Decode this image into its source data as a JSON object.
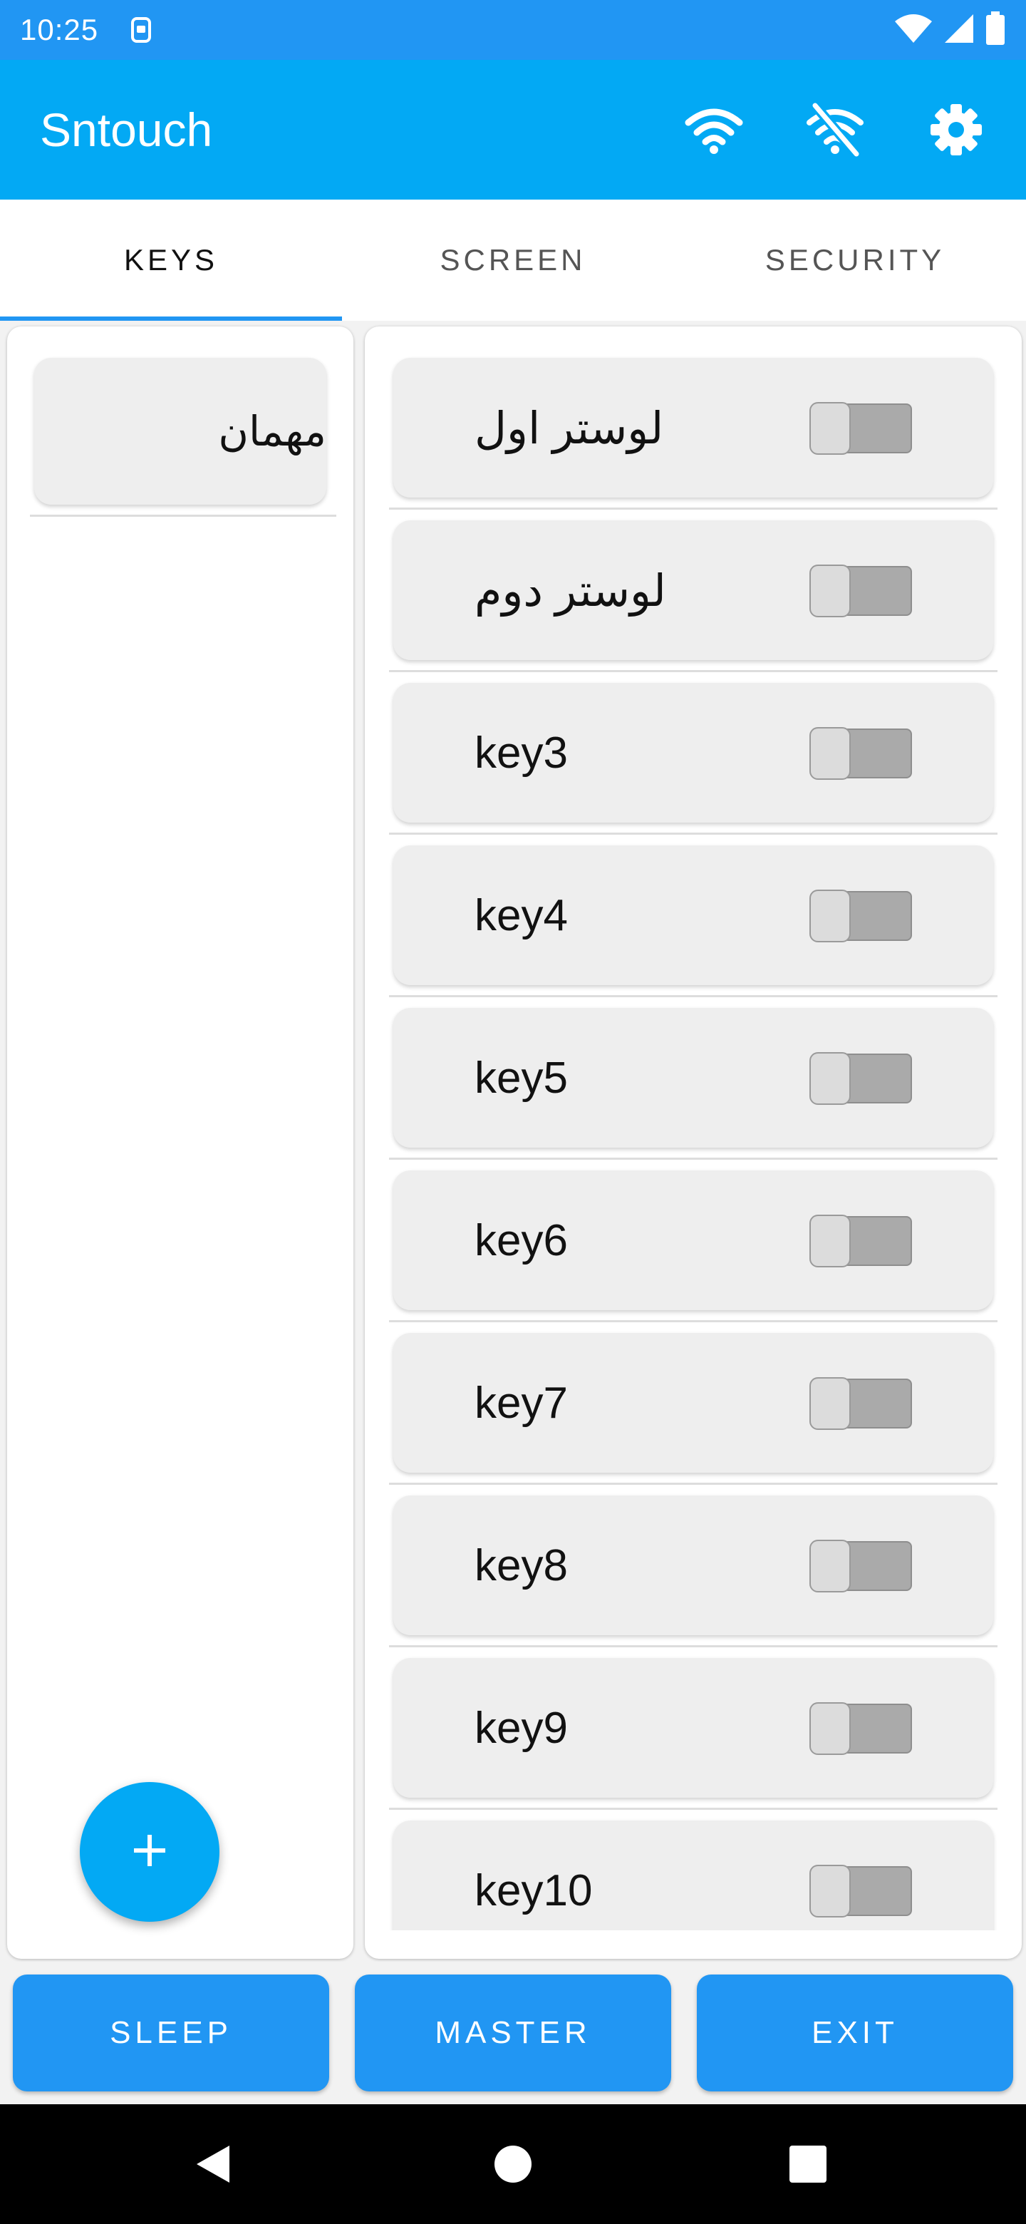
{
  "status_bar": {
    "time": "10:25",
    "icons": [
      "sim-card-icon",
      "wifi-full-icon",
      "cell-signal-icon",
      "battery-icon"
    ]
  },
  "app_bar": {
    "title": "Sntouch",
    "actions": [
      "wifi-icon",
      "wifi-off-icon",
      "settings-gear-icon"
    ],
    "color": "#03a9f4"
  },
  "tabs": [
    {
      "label": "KEYS",
      "active": true
    },
    {
      "label": "SCREEN",
      "active": false
    },
    {
      "label": "SECURITY",
      "active": false
    }
  ],
  "rooms": {
    "items": [
      {
        "label": "مهمان"
      }
    ],
    "add_button_icon": "plus-icon"
  },
  "keys": {
    "items": [
      {
        "label": "لوستر اول",
        "on": false
      },
      {
        "label": "لوستر دوم",
        "on": false
      },
      {
        "label": "key3",
        "on": false
      },
      {
        "label": "key4",
        "on": false
      },
      {
        "label": "key5",
        "on": false
      },
      {
        "label": "key6",
        "on": false
      },
      {
        "label": "key7",
        "on": false
      },
      {
        "label": "key8",
        "on": false
      },
      {
        "label": "key9",
        "on": false
      },
      {
        "label": "key10",
        "on": false
      }
    ]
  },
  "bottom_actions": {
    "sleep": "SLEEP",
    "master": "MASTER",
    "exit": "EXIT",
    "color": "#2196f3"
  },
  "nav_bar": {
    "icons": [
      "back-icon",
      "home-icon",
      "recents-icon"
    ]
  }
}
